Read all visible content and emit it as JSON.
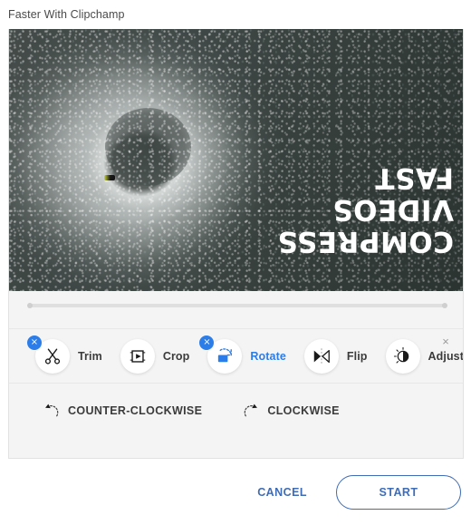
{
  "page_title": "Faster With Clipchamp",
  "colors": {
    "accent_blue": "#2b7de9",
    "button_blue": "#3f6db5",
    "panel_bg": "#f4f4f4",
    "text_dark": "#3b3b3b",
    "close_gray": "#9b9b9b"
  },
  "preview": {
    "overlay_lines": [
      "COMPRESS",
      "VIDEOS",
      "FAST"
    ],
    "description": "Aerial photo of a circular icy formation on dark water, rotated 180 degrees"
  },
  "toolbar": {
    "close_label": "×",
    "tools": [
      {
        "id": "trim",
        "label": "Trim",
        "icon": "scissors-icon",
        "active": false,
        "badge": "×"
      },
      {
        "id": "crop",
        "label": "Crop",
        "icon": "crop-icon",
        "active": false,
        "badge": ""
      },
      {
        "id": "rotate",
        "label": "Rotate",
        "icon": "rotate-icon",
        "active": true,
        "badge": "×"
      },
      {
        "id": "flip",
        "label": "Flip",
        "icon": "flip-icon",
        "active": false,
        "badge": ""
      },
      {
        "id": "adjust",
        "label": "Adjust",
        "icon": "brightness-icon",
        "active": false,
        "badge": ""
      }
    ]
  },
  "rotate_options": [
    {
      "id": "counter-clockwise",
      "label": "COUNTER-CLOCKWISE",
      "icon": "rotate-ccw-icon"
    },
    {
      "id": "clockwise",
      "label": "CLOCKWISE",
      "icon": "rotate-cw-icon"
    }
  ],
  "footer": {
    "cancel_label": "CANCEL",
    "start_label": "START"
  }
}
